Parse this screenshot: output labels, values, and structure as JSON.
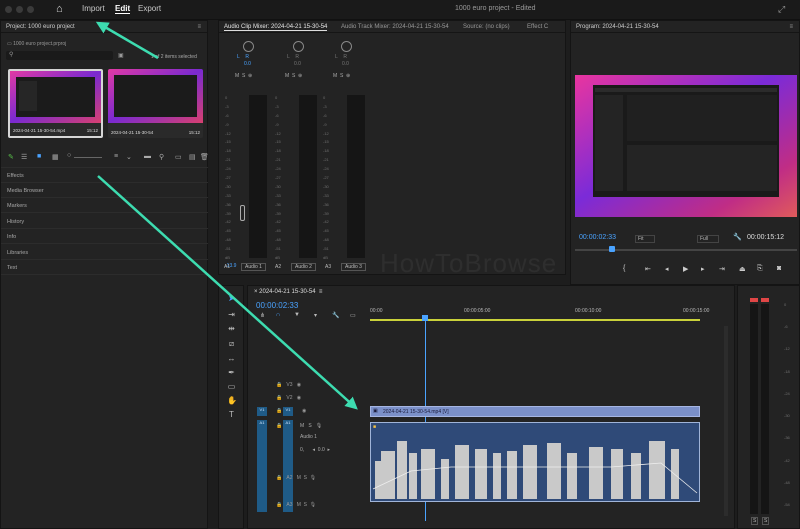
{
  "menu": {
    "import": "Import",
    "edit": "Edit",
    "export": "Export"
  },
  "app_title": "1000 euro project - Edited",
  "project": {
    "header": "Project: 1000 euro project",
    "file": "1000 euro project.prproj",
    "selected": "1 of 2 items selected",
    "items": [
      {
        "name": "2024-04-21 15-30-54.mp4",
        "dur": "15:12"
      },
      {
        "name": "2024-04-21 15-30-54",
        "dur": "15:12"
      }
    ],
    "sections": [
      "Effects",
      "Media Browser",
      "Markers",
      "History",
      "Info",
      "Libraries",
      "Text"
    ]
  },
  "mixer": {
    "tab1": "Audio Clip Mixer: 2024-04-21 15-30-54",
    "tab2": "Audio Track Mixer: 2024-04-21 15-30-54",
    "tab3": "Source: (no clips)",
    "tab4": "Effect C",
    "lr": "L",
    "r": "R",
    "pan_val": "0.0",
    "channels": [
      {
        "id": "A1",
        "name": "Audio 1"
      },
      {
        "id": "A2",
        "name": "Audio 2"
      },
      {
        "id": "A3",
        "name": "Audio 3"
      }
    ],
    "db_low": "-13.9",
    "scale": [
      "0",
      "-3",
      "-6",
      "-9",
      "-12",
      "-15",
      "-18",
      "-21",
      "-24",
      "-27",
      "-30",
      "-33",
      "-36",
      "-39",
      "-42",
      "-45",
      "-48",
      "-51",
      "dB"
    ]
  },
  "program": {
    "header": "Program: 2024-04-21 15-30-54",
    "timecode": "00:00:02:33",
    "fit": "Fit",
    "full": "Full",
    "duration": "00:00:15:12"
  },
  "timeline": {
    "tab": "2024-04-21 15-30-54",
    "timecode": "00:00:02:33",
    "ruler": [
      "00:00",
      "00:00:05:00",
      "00:00:10:00",
      "00:00:15:00"
    ],
    "tracks": [
      "V3",
      "V2",
      "V1",
      "A1",
      "A2",
      "A3"
    ],
    "audio_name": "Audio 1",
    "video_clip": "2024-04-21 15-30-54.mp4 [V]",
    "vol_val": "0.0",
    "colors": {
      "video_clip": "#7b90c9",
      "audio_clip": "#2f4a78",
      "playhead": "#4aa3ff",
      "track_btn": "#1f5b87"
    }
  },
  "meters": {
    "labels": [
      "S",
      "S"
    ],
    "scale": [
      "0",
      "-6",
      "-12",
      "-18",
      "-24",
      "-30",
      "-36",
      "-42",
      "-48",
      "-54"
    ]
  },
  "watermark": "HowToBrowse",
  "arrow_color": "#3ddcb0"
}
